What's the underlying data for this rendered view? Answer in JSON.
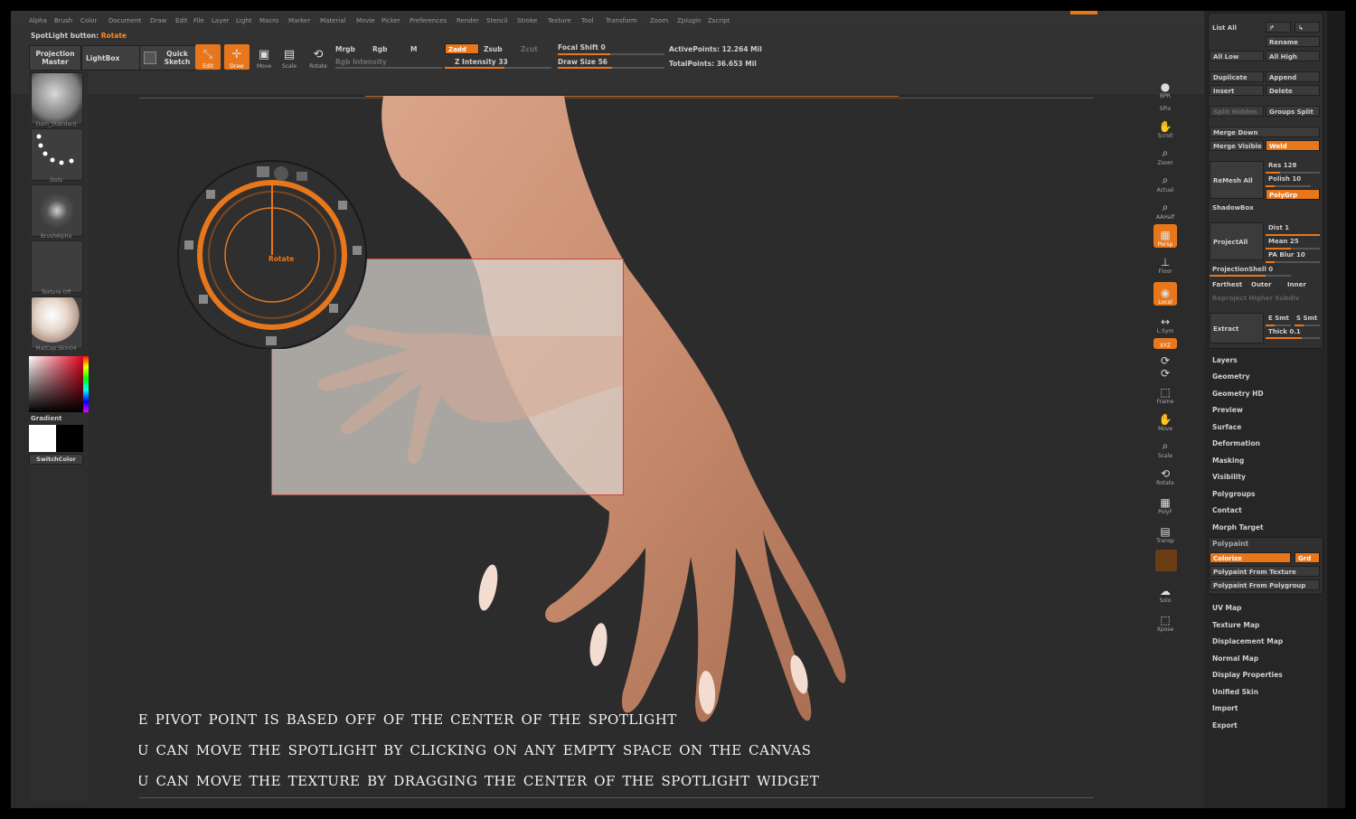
{
  "menu": [
    "Alpha",
    "Brush",
    "Color",
    "Document",
    "Draw",
    "Edit",
    "File",
    "Layer",
    "Light",
    "Macro",
    "Marker",
    "Material",
    "Movie",
    "Picker",
    "Preferences",
    "Render",
    "Stencil",
    "Stroke",
    "Texture",
    "Tool",
    "Transform",
    "Zoom",
    "Zplugin",
    "Zscript"
  ],
  "status": {
    "label": "SpotLight button:",
    "value": "Rotate"
  },
  "top": {
    "projection_master": "Projection Master",
    "lightbox": "LightBox",
    "quick_sketch": "Quick Sketch",
    "edit": "Edit",
    "draw": "Draw",
    "move": "Move",
    "scale": "Scale",
    "rotate": "Rotate",
    "mrgb": "Mrgb",
    "rgb": "Rgb",
    "m": "M",
    "rgb_intensity": "Rgb Intensity",
    "zadd": "Zadd",
    "zsub": "Zsub",
    "zcut": "Zcut",
    "z_intensity_label": "Z Intensity",
    "z_intensity": "33",
    "focal_shift_label": "Focal Shift",
    "focal_shift": "0",
    "draw_size_label": "Draw Size",
    "draw_size": "56",
    "active_points": "ActivePoints: 12.264 Mil",
    "total_points": "TotalPoints: 36.653 Mil"
  },
  "left": {
    "brush": "Dam_Standard",
    "stroke": "Dots",
    "alpha": "BrushAlpha",
    "texture": "Texture Off",
    "material": "MatCap Skin04",
    "gradient": "Gradient",
    "switch_color": "SwitchColor"
  },
  "spotlight": {
    "label": "Rotate"
  },
  "right_toolbar": [
    "BPR",
    "SPix",
    "Scroll",
    "Zoom",
    "Actual",
    "AAHalf",
    "Persp",
    "Floor",
    "Local",
    "L.Sym",
    "XYZ",
    "Frame",
    "Move",
    "Scale",
    "Rotate",
    "PolyF",
    "Transp",
    "Solo",
    "Xpose"
  ],
  "subtool": {
    "list_all": "List All",
    "rename": "Rename",
    "all_low": "All Low",
    "all_high": "All High",
    "duplicate": "Duplicate",
    "append": "Append",
    "insert": "Insert",
    "delete": "Delete",
    "split_hidden": "Split Hidden",
    "groups_split": "Groups Split",
    "merge_down": "Merge Down",
    "merge_visible": "Merge Visible",
    "weld": "Weld",
    "remesh_all": "ReMesh All",
    "res_label": "Res",
    "res": "128",
    "polish_label": "Polish",
    "polish": "10",
    "polygrp": "PolyGrp",
    "shadowbox": "ShadowBox",
    "project_all": "ProjectAll",
    "dist_label": "Dist",
    "dist": "1",
    "mean_label": "Mean",
    "mean": "25",
    "pa_blur_label": "PA Blur",
    "pa_blur": "10",
    "projection_shell_label": "ProjectionShell",
    "projection_shell": "0",
    "farthest": "Farthest",
    "outer": "Outer",
    "inner": "Inner",
    "reproject": "Reproject Higher Subdiv",
    "extract": "Extract",
    "e_smt": "E Smt",
    "s_smt": "S Smt",
    "thick_label": "Thick",
    "thick": "0.1"
  },
  "palettes": [
    "Layers",
    "Geometry",
    "Geometry HD",
    "Preview",
    "Surface",
    "Deformation",
    "Masking",
    "Visibility",
    "Polygroups",
    "Contact",
    "Morph Target"
  ],
  "polypaint": {
    "title": "Polypaint",
    "colorize": "Colorize",
    "grd": "Grd",
    "from_texture": "Polypaint From Texture",
    "from_polygroup": "Polypaint From Polygroup"
  },
  "palettes2": [
    "UV Map",
    "Texture Map",
    "Displacement Map",
    "Normal Map",
    "Display Properties",
    "Unified Skin",
    "Import",
    "Export"
  ],
  "caption": [
    "The pivot point is based off of the center of the spotlight",
    "You can move the spotlight by clicking on any empty space on the canvas",
    "You can move the texture by dragging the center of the spotlight widget"
  ],
  "colors": {
    "accent": "#e8771c",
    "panel": "#262626",
    "canvas": "#2c2c2c"
  }
}
